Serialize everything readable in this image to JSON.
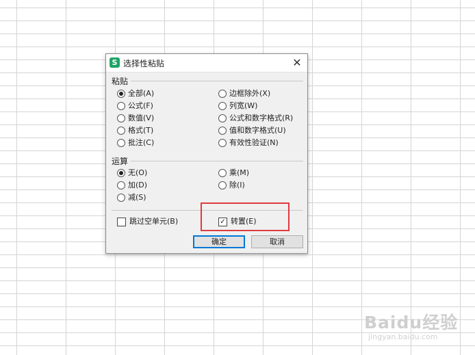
{
  "dialog": {
    "title": "选择性粘贴",
    "icon_letter": "S",
    "icon_color": "#21a366",
    "close_glyph": "✕",
    "paste_section": {
      "label": "粘贴",
      "options": [
        {
          "label": "全部(A)",
          "checked": true
        },
        {
          "label": "公式(F)",
          "checked": false
        },
        {
          "label": "数值(V)",
          "checked": false
        },
        {
          "label": "格式(T)",
          "checked": false
        },
        {
          "label": "批注(C)",
          "checked": false
        },
        {
          "label": "边框除外(X)",
          "checked": false
        },
        {
          "label": "列宽(W)",
          "checked": false
        },
        {
          "label": "公式和数字格式(R)",
          "checked": false
        },
        {
          "label": "值和数字格式(U)",
          "checked": false
        },
        {
          "label": "有效性验证(N)",
          "checked": false
        }
      ]
    },
    "operation_section": {
      "label": "运算",
      "options": [
        {
          "label": "无(O)",
          "checked": true
        },
        {
          "label": "加(D)",
          "checked": false
        },
        {
          "label": "减(S)",
          "checked": false
        },
        {
          "label": "乘(M)",
          "checked": false
        },
        {
          "label": "除(I)",
          "checked": false
        }
      ]
    },
    "skip_blanks": {
      "label": "跳过空单元(B)",
      "checked": false
    },
    "transpose": {
      "label": "转置(E)",
      "checked": true
    },
    "ok_label": "确定",
    "cancel_label": "取消"
  },
  "highlight_color": "#e0393e",
  "watermark": {
    "text": "Baidu经验",
    "sub": "jingyan.baidu.com"
  }
}
